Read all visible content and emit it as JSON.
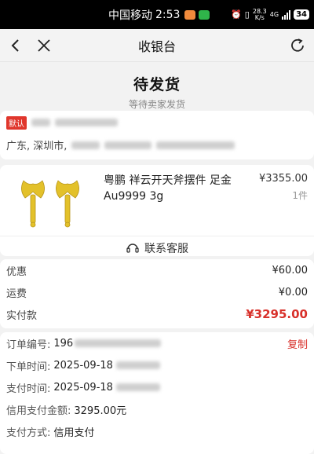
{
  "status_bar": {
    "carrier": "中国移动",
    "time": "2:53",
    "network_speed": "28.3 K/s",
    "network_type": "4G",
    "battery": "34"
  },
  "nav": {
    "title": "收银台"
  },
  "order_status": {
    "title": "待发货",
    "subtitle": "等待卖家发货"
  },
  "address": {
    "default_tag": "默认",
    "region": "广东, 深圳市,"
  },
  "goods": {
    "name": "粤鹏 祥云开天斧摆件 足金 Au9999 3g",
    "price": "¥3355.00",
    "quantity": "1件"
  },
  "customer_service": {
    "label": "联系客服"
  },
  "fees": [
    {
      "label": "优惠",
      "value": "¥60.00"
    },
    {
      "label": "运费",
      "value": "¥0.00"
    },
    {
      "label": "实付款",
      "value": "¥3295.00"
    }
  ],
  "order_info": {
    "order_no_label": "订单编号:",
    "order_no_value": "196",
    "copy_label": "复制",
    "order_time_label": "下单时间:",
    "order_time_value": "2025-09-18",
    "pay_time_label": "支付时间:",
    "pay_time_value": "2025-09-18",
    "credit_amount_label": "信用支付金额:",
    "credit_amount_value": "3295.00元",
    "pay_method_label": "支付方式:",
    "pay_method_value": "信用支付"
  },
  "colors": {
    "accent_red": "#d8302a",
    "tag_red": "#e0362c",
    "gold": "#e3c12a"
  }
}
